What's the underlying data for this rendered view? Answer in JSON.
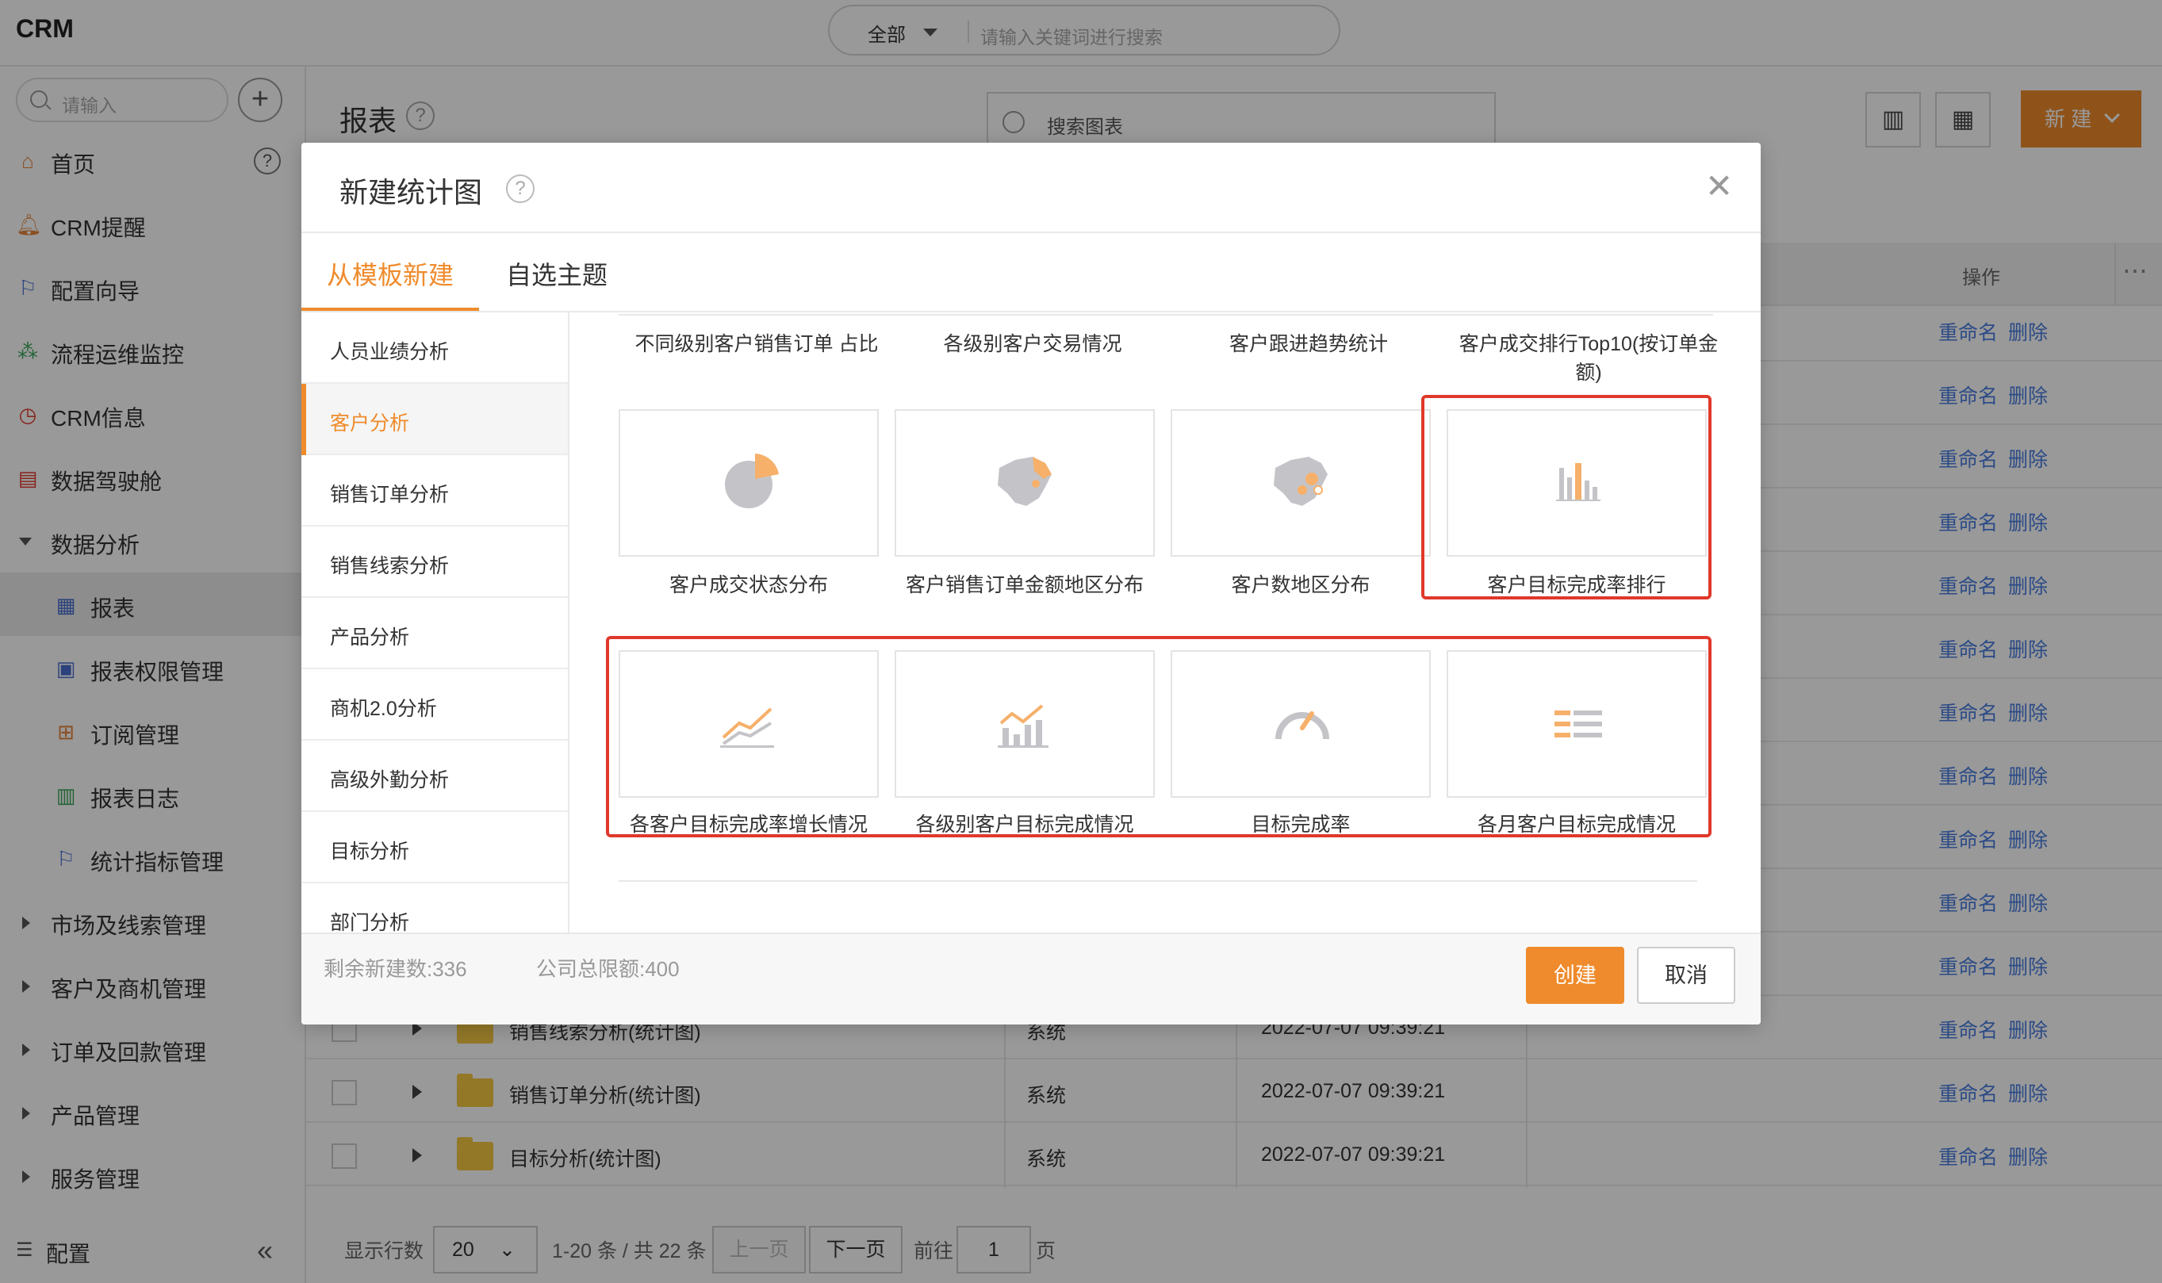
{
  "app": {
    "title": "CRM"
  },
  "global_search": {
    "scope": "全部",
    "placeholder": "请输入关键词进行搜索"
  },
  "sidebar": {
    "search_placeholder": "请输入",
    "items": [
      {
        "label": "首页",
        "icon": "home-icon"
      },
      {
        "label": "CRM提醒",
        "icon": "bell-icon"
      },
      {
        "label": "配置向导",
        "icon": "flag-icon"
      },
      {
        "label": "流程运维监控",
        "icon": "flow-icon"
      },
      {
        "label": "CRM信息",
        "icon": "clock-icon"
      },
      {
        "label": "数据驾驶舱",
        "icon": "dashboard-icon"
      },
      {
        "label": "数据分析",
        "icon": "expand-icon"
      },
      {
        "label": "报表",
        "icon": "report-icon"
      },
      {
        "label": "报表权限管理",
        "icon": "report-lock-icon"
      },
      {
        "label": "订阅管理",
        "icon": "subscribe-icon"
      },
      {
        "label": "报表日志",
        "icon": "log-icon"
      },
      {
        "label": "统计指标管理",
        "icon": "flag-icon"
      },
      {
        "label": "市场及线索管理",
        "icon": "collapse-icon"
      },
      {
        "label": "客户及商机管理",
        "icon": "collapse-icon"
      },
      {
        "label": "订单及回款管理",
        "icon": "collapse-icon"
      },
      {
        "label": "产品管理",
        "icon": "collapse-icon"
      },
      {
        "label": "服务管理",
        "icon": "collapse-icon"
      }
    ],
    "footer_label": "配置"
  },
  "main": {
    "title": "报表",
    "search_placeholder": "搜索图表",
    "new_button": "新 建",
    "op_header": "操作",
    "row_actions": {
      "rename": "重命名",
      "delete": "删除"
    },
    "rows": [
      {
        "name": "销售线索分析(统计图)",
        "type": "系统",
        "time": "2022-07-07 09:39:21"
      },
      {
        "name": "销售订单分析(统计图)",
        "type": "系统",
        "time": "2022-07-07 09:39:21"
      },
      {
        "name": "目标分析(统计图)",
        "type": "系统",
        "time": "2022-07-07 09:39:21"
      }
    ],
    "pager": {
      "rows_label": "显示行数",
      "page_size": "20",
      "range": "1-20 条 / 共 22 条",
      "prev": "上一页",
      "next": "下一页",
      "goto": "前往",
      "page": "1",
      "page_unit": "页"
    }
  },
  "modal": {
    "title": "新建统计图",
    "tabs": [
      "从模板新建",
      "自选主题"
    ],
    "categories": [
      "人员业绩分析",
      "客户分析",
      "销售订单分析",
      "销售线索分析",
      "产品分析",
      "商机2.0分析",
      "高级外勤分析",
      "目标分析",
      "部门分析"
    ],
    "top_labels": [
      "不同级别客户销售订单 占比",
      "各级别客户交易情况",
      "客户跟进趋势统计",
      "客户成交排行Top10(按订单金额)"
    ],
    "templates": [
      {
        "label": "客户成交状态分布",
        "icon": "pie-chart-icon"
      },
      {
        "label": "客户销售订单金额地区分布",
        "icon": "map-icon"
      },
      {
        "label": "客户数地区分布",
        "icon": "map-dots-icon"
      },
      {
        "label": "客户目标完成率排行",
        "icon": "bar-chart-icon"
      },
      {
        "label": "各客户目标完成率增长情况",
        "icon": "line-chart-icon"
      },
      {
        "label": "各级别客户目标完成情况",
        "icon": "bar-line-chart-icon"
      },
      {
        "label": "目标完成率",
        "icon": "gauge-icon"
      },
      {
        "label": "各月客户目标完成情况",
        "icon": "table-chart-icon"
      }
    ],
    "footer": {
      "remaining": "剩余新建数:336",
      "limit": "公司总限额:400",
      "create": "创建",
      "cancel": "取消"
    }
  },
  "colors": {
    "accent": "#ef8b2c",
    "link": "#4a7de0",
    "highlight": "#e0392b"
  }
}
